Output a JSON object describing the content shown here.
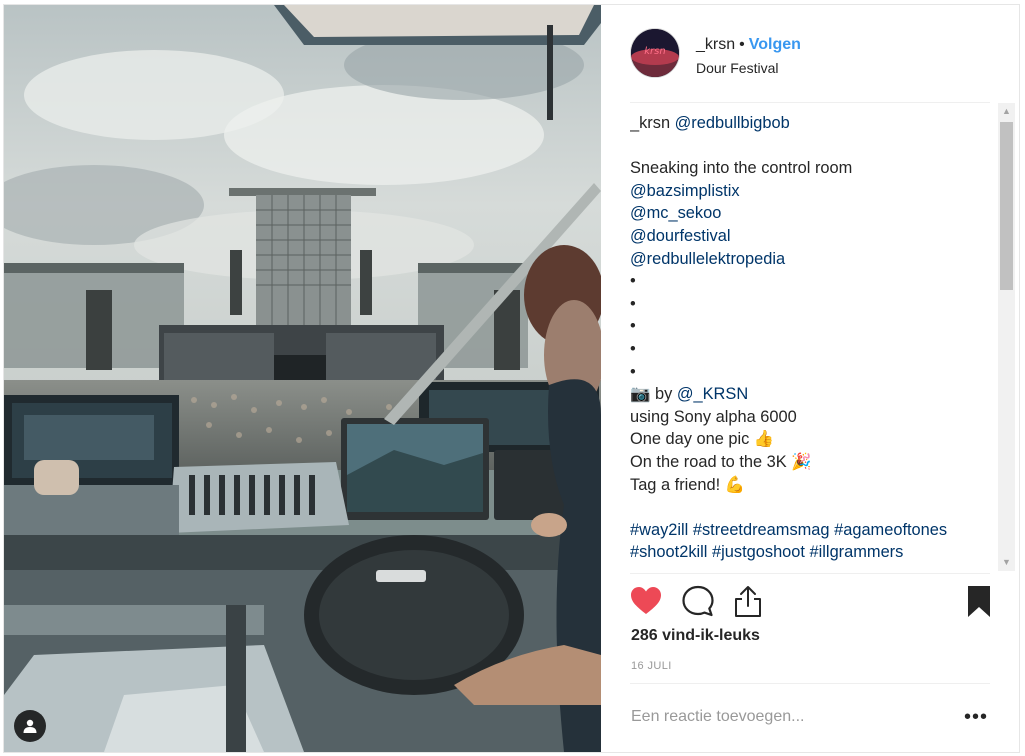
{
  "post": {
    "username": "_krsn",
    "separator": "•",
    "follow_label": "Volgen",
    "location": "Dour Festival",
    "avatar_icon": "profile-avatar"
  },
  "caption": {
    "author": "_krsn",
    "mention": "@redbullbigbob",
    "lines": [
      {
        "text": "Sneaking into the control room",
        "link": false
      },
      {
        "text": "@bazsimplistix",
        "link": true
      },
      {
        "text": "@mc_sekoo",
        "link": true
      },
      {
        "text": "@dourfestival",
        "link": true
      },
      {
        "text": "@redbullelektropedia",
        "link": true
      },
      {
        "text": "•",
        "link": false
      },
      {
        "text": "•",
        "link": false
      },
      {
        "text": "•",
        "link": false
      },
      {
        "text": "•",
        "link": false
      },
      {
        "text": "•",
        "link": false
      }
    ],
    "photo_line": {
      "icon": "📷",
      "by": "by",
      "mention": "@_KRSN"
    },
    "lines2": [
      "using Sony alpha 6000",
      "One day one pic 👍",
      "On the road to the 3K 🎉",
      "Tag a friend! 💪"
    ],
    "hashtags_line1": [
      "#way2ill",
      "#streetdreamsmag",
      "#agameoftones"
    ],
    "hashtags_line2": [
      "#shoot2kill",
      "#justgoshoot",
      "#illgrammers"
    ]
  },
  "actions": {
    "like_icon": "heart-icon",
    "comment_icon": "comment-icon",
    "share_icon": "share-icon",
    "save_icon": "bookmark-icon",
    "liked": true,
    "like_color": "#ed4956"
  },
  "likes_label": "286 vind-ik-leuks",
  "date_label": "16 JULI",
  "comment": {
    "placeholder": "Een reactie toevoegen...",
    "more_label": "•••"
  },
  "colors": {
    "link": "#003569",
    "follow": "#3897f0",
    "text": "#262626",
    "muted": "#999999"
  }
}
